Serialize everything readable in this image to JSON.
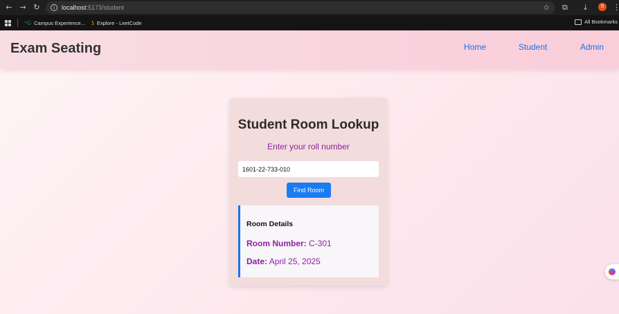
{
  "browser": {
    "url_host": "localhost",
    "url_path": ":5173/student",
    "profile_initial": "S",
    "bookmarks": [
      {
        "label": "Campus Experience...",
        "icon": "gfg-icon"
      },
      {
        "label": "Explore - LeetCode",
        "icon": "leetcode-icon"
      }
    ],
    "all_bookmarks": "All Bookmarks"
  },
  "navbar": {
    "brand": "Exam Seating",
    "links": [
      "Home",
      "Student",
      "Admin"
    ]
  },
  "lookup": {
    "title": "Student Room Lookup",
    "subtitle": "Enter your roll number",
    "roll_value": "1601-22-733-010",
    "button": "Find Room"
  },
  "details": {
    "title": "Room Details",
    "room_label": "Room Number:",
    "room_value": "C-301",
    "date_label": "Date:",
    "date_value": "April 25, 2025"
  },
  "colors": {
    "accent": "#1a7cf2",
    "purple_text": "#8e1fa5",
    "card_bg": "#f3dcdc"
  }
}
